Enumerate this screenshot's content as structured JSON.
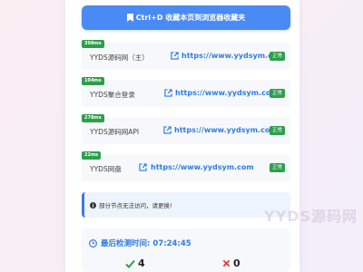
{
  "bookmark": {
    "label": "Ctrl+D 收藏本页到浏览器收藏夹"
  },
  "sites": [
    {
      "latency": "398ms",
      "name": "YYDS源码网（主）",
      "url": "https://www.yydsym.com",
      "status": "正常"
    },
    {
      "latency": "104ms",
      "name": "YYDS聚合登录",
      "url": "https://www.yydsym.com",
      "status": "正常"
    },
    {
      "latency": "278ms",
      "name": "YYDS源码网API",
      "url": "https://www.yydsym.com",
      "status": "正常"
    },
    {
      "latency": "22ms",
      "name": "YYDS网盘",
      "url": "https://www.yydsym.com",
      "status": "正常"
    }
  ],
  "notice": {
    "text": "部分节点无法访问，请更换!"
  },
  "check": {
    "label": "最后检测时间: 07:24:45",
    "ok_count": "4",
    "fail_count": "0"
  },
  "watermark": "YYDS源码网",
  "colors": {
    "accent": "#4a8af4",
    "success": "#2e9e4a",
    "fail": "#e0393e"
  }
}
